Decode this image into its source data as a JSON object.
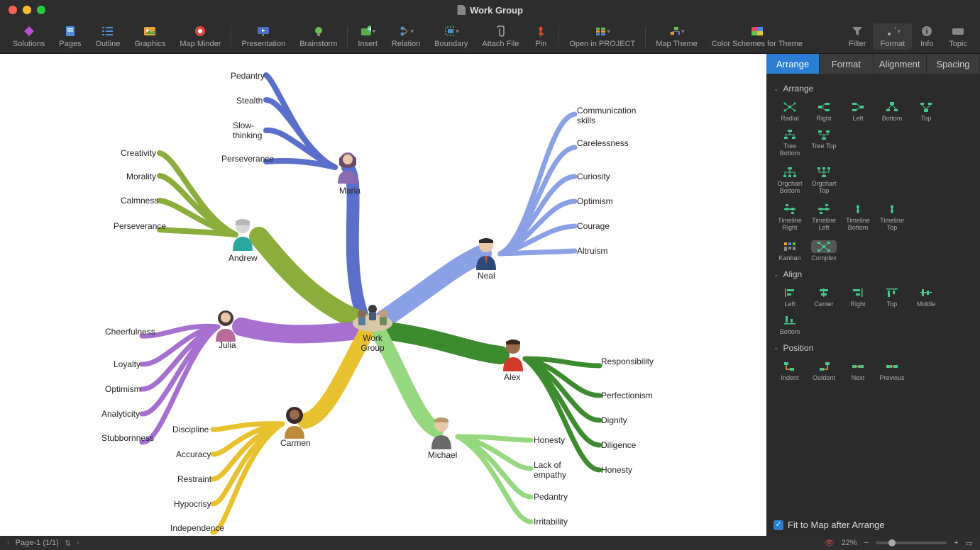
{
  "titlebar": {
    "title": "Work Group"
  },
  "toolbar": {
    "items": [
      {
        "label": "Solutions"
      },
      {
        "label": "Pages"
      },
      {
        "label": "Outline"
      },
      {
        "label": "Graphics"
      },
      {
        "label": "Map Minder"
      },
      {
        "label": "Presentation"
      },
      {
        "label": "Brainstorm"
      },
      {
        "label": "Insert"
      },
      {
        "label": "Relation"
      },
      {
        "label": "Boundary"
      },
      {
        "label": "Attach File"
      },
      {
        "label": "Pin"
      },
      {
        "label": "Open in PROJECT"
      },
      {
        "label": "Map Theme"
      },
      {
        "label": "Color Schemes for Theme"
      },
      {
        "label": "Filter"
      },
      {
        "label": "Format"
      },
      {
        "label": "Info"
      },
      {
        "label": "Topic"
      }
    ]
  },
  "mindmap": {
    "center": {
      "label": "Work Group"
    },
    "people": {
      "maria": {
        "name": "Maria",
        "color": "#5a6fc9",
        "traits": [
          "Pedantry",
          "Stealth",
          "Slow-thinking",
          "Perseverance"
        ]
      },
      "neal": {
        "name": "Neal",
        "color": "#8aa1e6",
        "traits": [
          "Communication skills",
          "Carelessness",
          "Curiosity",
          "Optimism",
          "Courage",
          "Altruism"
        ]
      },
      "andrew": {
        "name": "Andrew",
        "color": "#8aad3c",
        "traits": [
          "Creativity",
          "Morality",
          "Calmness",
          "Perseverance"
        ]
      },
      "alex": {
        "name": "Alex",
        "color": "#3d8b2f",
        "traits": [
          "Responsibility",
          "Perfectionism",
          "Dignity",
          "Diligence",
          "Honesty"
        ]
      },
      "julia": {
        "name": "Julia",
        "color": "#a66fd0",
        "traits": [
          "Cheerfulness",
          "Loyalty",
          "Optimism",
          "Analyticity",
          "Stubbornness"
        ]
      },
      "michael": {
        "name": "Michael",
        "color": "#95d880",
        "traits": [
          "Honesty",
          "Lack of empathy",
          "Pedantry",
          "Irritability"
        ]
      },
      "carmen": {
        "name": "Carmen",
        "color": "#e8c22e",
        "traits": [
          "Discipline",
          "Accuracy",
          "Restraint",
          "Hypocrisy",
          "Independence"
        ]
      }
    }
  },
  "panel": {
    "tabs": [
      "Arrange",
      "Format",
      "Alignment",
      "Spacing"
    ],
    "activeTab": "Arrange",
    "sections": {
      "arrange": {
        "title": "Arrange",
        "items": [
          "Radial",
          "Right",
          "Left",
          "Bottom",
          "Top",
          "Tree Bottom",
          "Tree Top",
          "Orgchart Bottom",
          "Orgchart Top",
          "Timeline Right",
          "Timeline Left",
          "Timeline Bottom",
          "Timeline Top",
          "Kanban",
          "Complex"
        ],
        "selected": "Complex"
      },
      "align": {
        "title": "Align",
        "items": [
          "Left",
          "Center",
          "Right",
          "Top",
          "Middle",
          "Bottom"
        ]
      },
      "position": {
        "title": "Position",
        "items": [
          "Indent",
          "Outdent",
          "Next",
          "Previous"
        ]
      }
    },
    "fitToMap": "Fit to Map after Arrange"
  },
  "statusbar": {
    "page": "Page-1 (1/1)",
    "zoom": "22%"
  }
}
